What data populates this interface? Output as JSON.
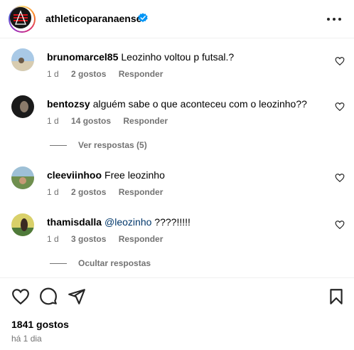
{
  "header": {
    "username": "athleticoparanaense",
    "verified_icon": "verified-badge-icon",
    "more_icon": "more-horizontal-icon",
    "brand_color": "#0095f6"
  },
  "comments": [
    {
      "username": "brunomarcel85",
      "text": "Leozinho voltou p futsal.?",
      "time": "1 d",
      "likes": "2 gostos",
      "reply": "Responder"
    },
    {
      "username": "bentozsy",
      "text": "alguém sabe o que aconteceu com o leozinho??",
      "time": "1 d",
      "likes": "14 gostos",
      "reply": "Responder",
      "thread_toggle": "Ver respostas (5)"
    },
    {
      "username": "cleeviinhoo",
      "text": "Free leozinho",
      "time": "1 d",
      "likes": "2 gostos",
      "reply": "Responder"
    },
    {
      "username": "thamisdalla",
      "mention": "@leozinho",
      "text": " ????!!!!!",
      "time": "1 d",
      "likes": "3 gostos",
      "reply": "Responder",
      "thread_toggle": "Ocultar respostas"
    }
  ],
  "footer": {
    "likes_total": "1841 gostos",
    "time_ago": "há 1 dia",
    "icons": [
      "heart-icon",
      "comment-icon",
      "share-icon",
      "save-icon"
    ]
  }
}
